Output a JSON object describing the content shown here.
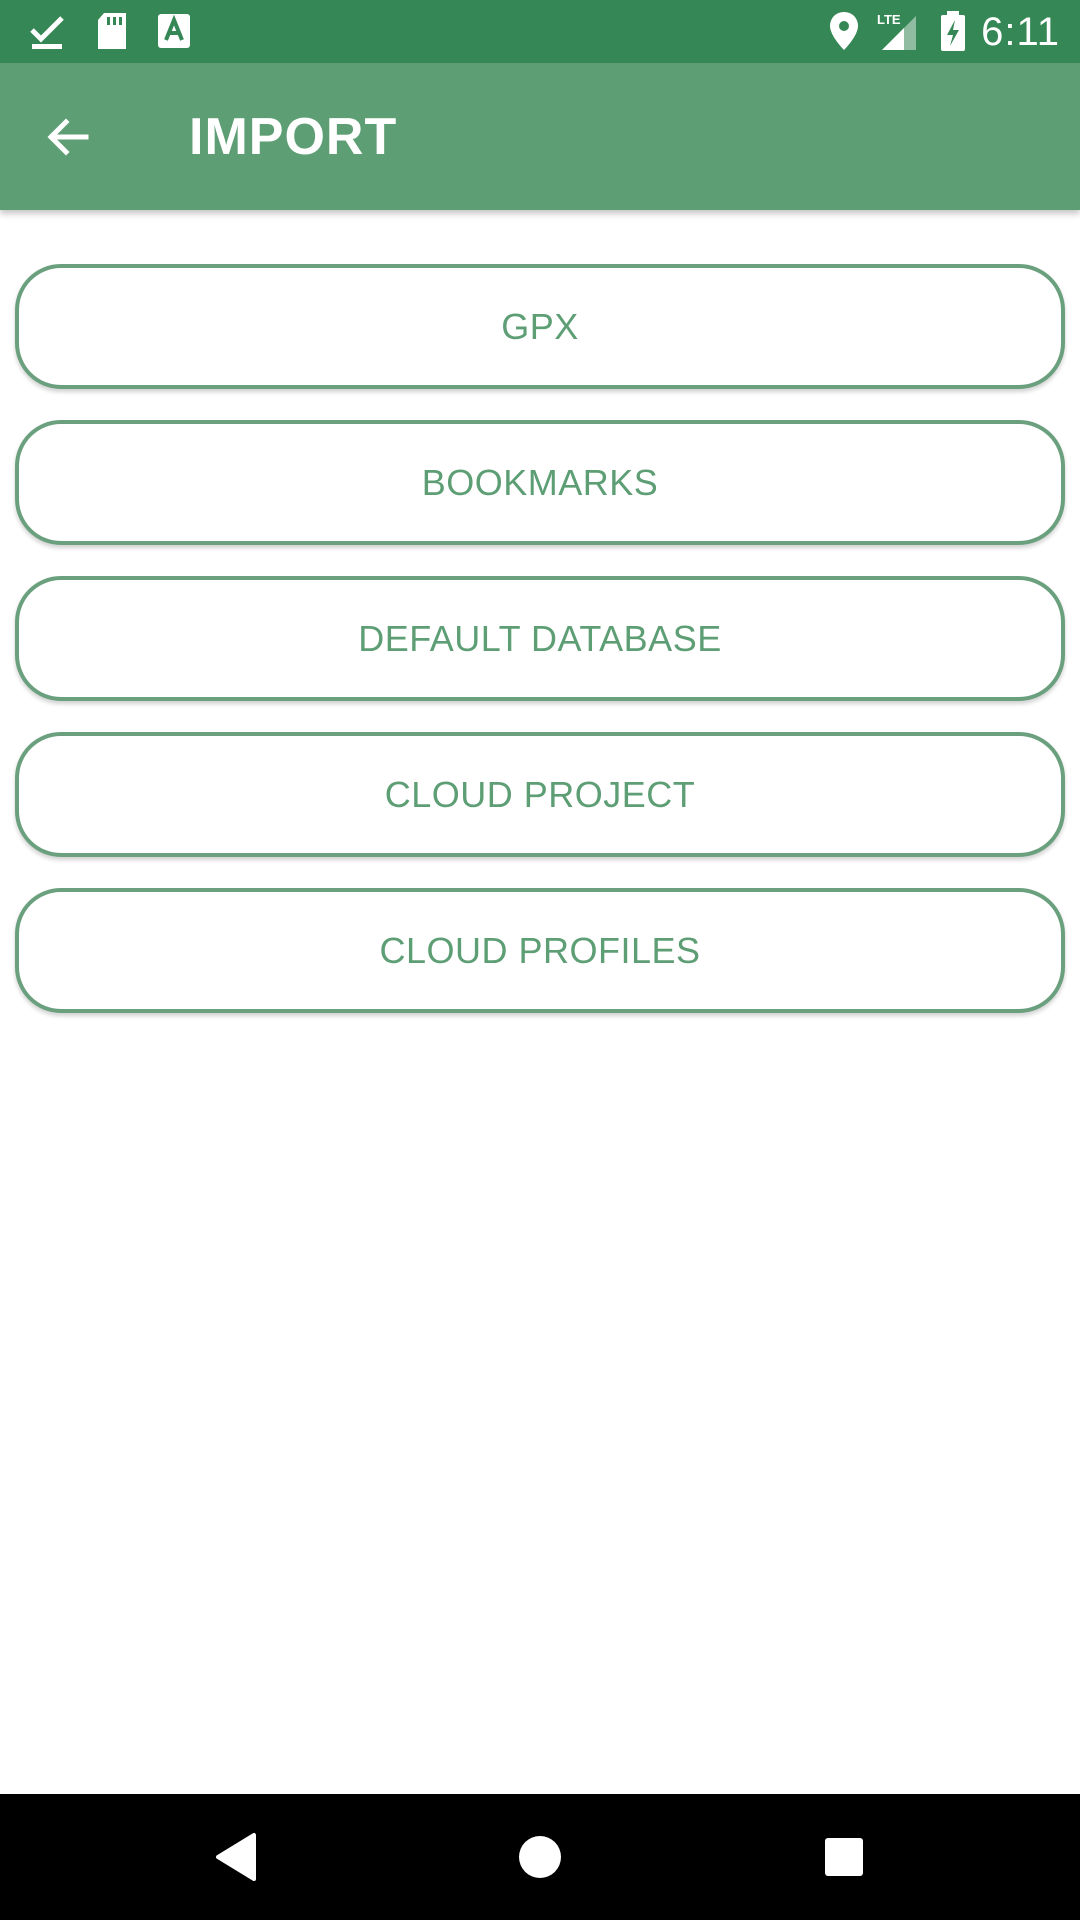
{
  "status_bar": {
    "time": "6:11",
    "left_icons": [
      "download-done-icon",
      "sd-card-icon",
      "font-app-icon"
    ],
    "right_icons": [
      "location-icon",
      "lte-signal-icon",
      "battery-charging-icon"
    ],
    "lte_label": "LTE"
  },
  "app_bar": {
    "title": "IMPORT",
    "back_icon": "arrow-back-icon"
  },
  "import_options": [
    {
      "label": "GPX"
    },
    {
      "label": "BOOKMARKS"
    },
    {
      "label": "DEFAULT DATABASE"
    },
    {
      "label": "CLOUD PROJECT"
    },
    {
      "label": "CLOUD PROFILES"
    }
  ],
  "nav_bar": {
    "icons": [
      "back-triangle-icon",
      "home-circle-icon",
      "recents-square-icon"
    ]
  },
  "colors": {
    "status_bar": "#358855",
    "app_bar": "#5d9e75",
    "accent": "#5d9e75",
    "button_border": "#6aa07e",
    "nav_bar": "#000000"
  }
}
